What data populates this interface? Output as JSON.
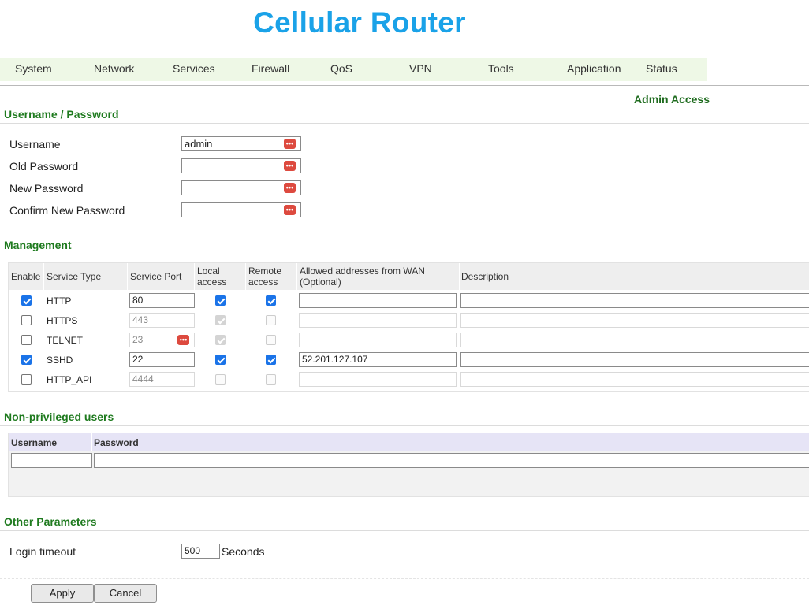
{
  "app": {
    "title": "Cellular Router"
  },
  "menu": {
    "items": [
      "System",
      "Network",
      "Services",
      "Firewall",
      "QoS",
      "VPN",
      "Tools",
      "Application",
      "Status"
    ]
  },
  "page": {
    "heading": "Admin Access"
  },
  "credentials": {
    "section_title": "Username / Password",
    "fields": [
      {
        "label": "Username",
        "value": "admin"
      },
      {
        "label": "Old Password",
        "value": ""
      },
      {
        "label": "New Password",
        "value": ""
      },
      {
        "label": "Confirm New Password",
        "value": ""
      }
    ]
  },
  "management": {
    "section_title": "Management",
    "headers": {
      "enable": "Enable",
      "service_type": "Service Type",
      "service_port": "Service Port",
      "local_access": "Local access",
      "remote_access": "Remote access",
      "allowed_addresses": "Allowed addresses from WAN (Optional)",
      "description": "Description"
    },
    "rows": [
      {
        "enabled": true,
        "service": "HTTP",
        "port": "80",
        "local": true,
        "remote": true,
        "allowed": "",
        "description": "",
        "editable": true,
        "key_icon": false
      },
      {
        "enabled": false,
        "service": "HTTPS",
        "port": "443",
        "local": true,
        "remote": false,
        "allowed": "",
        "description": "",
        "editable": false,
        "key_icon": false
      },
      {
        "enabled": false,
        "service": "TELNET",
        "port": "23",
        "local": true,
        "remote": false,
        "allowed": "",
        "description": "",
        "editable": false,
        "key_icon": true
      },
      {
        "enabled": true,
        "service": "SSHD",
        "port": "22",
        "local": true,
        "remote": true,
        "allowed": "52.201.127.107",
        "description": "",
        "editable": true,
        "key_icon": false
      },
      {
        "enabled": false,
        "service": "HTTP_API",
        "port": "4444",
        "local": false,
        "remote": false,
        "allowed": "",
        "description": "",
        "editable": false,
        "key_icon": false
      }
    ]
  },
  "users": {
    "section_title": "Non-privileged users",
    "headers": {
      "username": "Username",
      "password": "Password"
    },
    "rows": [
      {
        "username": "",
        "password": ""
      }
    ]
  },
  "other": {
    "section_title": "Other Parameters",
    "login_timeout_label": "Login timeout",
    "login_timeout_value": "500",
    "login_timeout_unit": "Seconds"
  },
  "buttons": {
    "apply": "Apply",
    "cancel": "Cancel"
  },
  "icons": {
    "password_field_icon": "password-key-icon"
  },
  "colors": {
    "title": "#1aa2e8",
    "menu_bg": "#eef8e6",
    "section_title": "#1e7a1e",
    "checkbox_checked": "#1a73e8",
    "key_icon": "#dd4a3f"
  }
}
